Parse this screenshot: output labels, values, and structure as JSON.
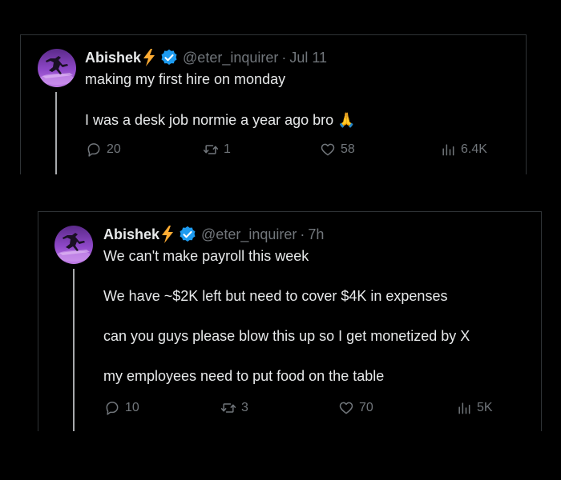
{
  "tweets": [
    {
      "display_name": "Abishek",
      "handle": "@eter_inquirer",
      "timestamp": "Jul 11",
      "lines": [
        "making my first hire on monday",
        "I was a desk job normie a year ago bro 🙏"
      ],
      "replies": "20",
      "reposts": "1",
      "likes": "58",
      "views": "6.4K"
    },
    {
      "display_name": "Abishek",
      "handle": "@eter_inquirer",
      "timestamp": "7h",
      "lines": [
        "We can't make payroll this week",
        "We have ~$2K left but need to cover $4K in expenses",
        "can you guys please blow this up so I get monetized by X",
        "my employees need to put food on the table"
      ],
      "replies": "10",
      "reposts": "3",
      "likes": "70",
      "views": "5K"
    }
  ],
  "colors": {
    "background": "#000000",
    "text": "#e7e9ea",
    "muted": "#71767b",
    "verified": "#1d9bf0",
    "bolt": "#ffac33",
    "border": "#2f3336"
  },
  "icons": [
    "avatar",
    "lightning-bolt-icon",
    "verified-badge-icon",
    "reply-icon",
    "repost-icon",
    "like-icon",
    "views-icon"
  ]
}
